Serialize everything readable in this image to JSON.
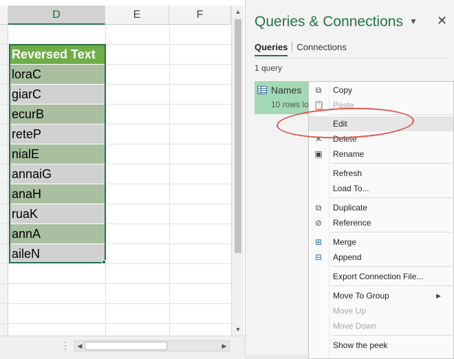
{
  "sheet": {
    "columns": [
      "D",
      "E",
      "F"
    ],
    "table_header": "Reversed Text",
    "rows": [
      "loraC",
      "giarC",
      "ecurB",
      "reteP",
      "nialE",
      "annaiG",
      "anaH",
      "ruaK",
      "annA",
      "aileN"
    ]
  },
  "pane": {
    "title": "Queries & Connections",
    "tabs": [
      "Queries",
      "Connections"
    ],
    "count": "1 query",
    "query_name": "Names",
    "query_sub": "10 rows lo"
  },
  "menu": {
    "items": [
      {
        "label": "Copy",
        "icon": "copy-icon",
        "disabled": false
      },
      {
        "label": "Paste",
        "icon": "paste-icon",
        "disabled": true
      },
      {
        "label": "Edit",
        "icon": "",
        "disabled": false
      },
      {
        "label": "Delete",
        "icon": "delete-icon",
        "disabled": false
      },
      {
        "label": "Rename",
        "icon": "rename-icon",
        "disabled": false
      },
      {
        "label": "Refresh",
        "icon": "",
        "disabled": false
      },
      {
        "label": "Load To...",
        "icon": "",
        "disabled": false
      },
      {
        "label": "Duplicate",
        "icon": "duplicate-icon",
        "disabled": false
      },
      {
        "label": "Reference",
        "icon": "reference-icon",
        "disabled": false
      },
      {
        "label": "Merge",
        "icon": "merge-icon",
        "disabled": false
      },
      {
        "label": "Append",
        "icon": "append-icon",
        "disabled": false
      },
      {
        "label": "Export Connection File...",
        "icon": "",
        "disabled": false
      },
      {
        "label": "Move To Group",
        "icon": "",
        "disabled": false
      },
      {
        "label": "Move Up",
        "icon": "",
        "disabled": true
      },
      {
        "label": "Move Down",
        "icon": "",
        "disabled": true
      },
      {
        "label": "Show the peek",
        "icon": "",
        "disabled": false
      }
    ]
  },
  "colors": {
    "accent": "#217346",
    "table_header_bg": "#70ad47",
    "annotation": "#e0534f"
  }
}
